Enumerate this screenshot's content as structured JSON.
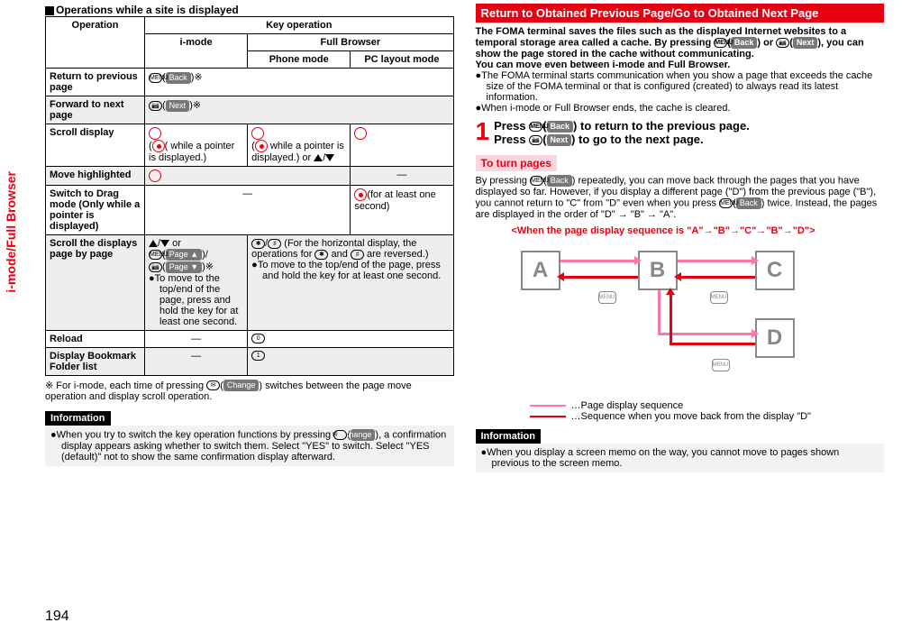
{
  "side_tab": "i-mode/Full Browser",
  "heading_left": "Operations while a site is displayed",
  "table_headers": {
    "operation": "Operation",
    "key_op": "Key operation",
    "imode": "i-mode",
    "fullbrowser": "Full Browser",
    "phone": "Phone mode",
    "pc": "PC layout mode"
  },
  "rows": {
    "r1_op": "Return to previous page",
    "r1_key_pre": "(",
    "r1_key_btn": "Back",
    "r1_key_post": ")※",
    "r2_op": "Forward to next page",
    "r2_key_btn": "Next",
    "r2_key_post": ")※",
    "r3_op": "Scroll display",
    "r3_cell1": "( while a pointer is displayed.)",
    "r3_cell2a": "(",
    "r3_cell2b": " while a pointer is displayed.) or ",
    "r4_op": "Move highlighted",
    "r4_dash": "—",
    "r5_op": "Switch to Drag mode (Only while a pointer is displayed)",
    "r5_dash": "—",
    "r5_pc": "(for at least one second)",
    "r6_op": "Scroll the displays page by page",
    "r6_imode_a": "/",
    "r6_imode_b": " or",
    "r6_btn_page_up": "Page ▲",
    "r6_btn_page_dn": "Page ▼",
    "r6_imode_c": ")※",
    "r6_imode_bullet": "To move to the top/end of the page, press and hold the key for at least one second.",
    "r6_full_a": "/",
    "r6_full_b": " (For the horizontal display, the operations for ",
    "r6_full_c": " and ",
    "r6_full_d": " are reversed.)",
    "r6_full_bullet": "To move to the top/end of the page, press and hold the key for at least one second.",
    "r7_op": "Reload",
    "r7_dash": "—",
    "r8_op": "Display Bookmark Folder list",
    "r8_dash": "—"
  },
  "footnote": "※ For i-mode, each time of pressing ",
  "footnote_btn": "Change",
  "footnote2": ") switches between the page move operation and display scroll operation.",
  "info_label": "Information",
  "info_left": "When you try to switch the key operation functions by pressing ",
  "info_left_btn": "Change",
  "info_left2": "), a confirmation display appears asking whether to switch them. Select \"YES\" to switch. Select \"YES (default)\" not to show the same confirmation display afterward.",
  "red_heading": "Return to Obtained Previous Page/Go to Obtained Next Page",
  "right_para1a": "The FOMA terminal saves the files such as the displayed Internet websites to a temporal storage area called a cache. By pressing ",
  "right_back": "Back",
  "right_or": ") or ",
  "right_next": "Next",
  "right_para1b": "), you can show the page stored in the cache without communicating.",
  "right_para2": "You can move even between i-mode and Full Browser.",
  "right_b1": "The FOMA terminal starts communication when you show a page that exceeds the cache size of the FOMA terminal or that is configured (created) to always read its latest information.",
  "right_b2": "When i-mode or Full Browser ends, the cache is cleared.",
  "step1a": "Press ",
  "step1b": ") to return to the previous page.",
  "step2a": "Press ",
  "step2b": ") to go to the next page.",
  "pink_heading": "To turn pages",
  "turn_p1a": "By pressing ",
  "turn_p1b": ") repeatedly, you can move back through the pages that you have displayed so far. However, if you display a different page (\"D\") from the previous page (\"B\"), you cannot return to \"C\" from \"D\" even when you press ",
  "turn_p1c": ") twice. Instead, the pages are displayed in the order of \"D\" → \"B\" → \"A\".",
  "diag_title": "<When the page display sequence is \"A\"→\"B\"→\"C\"→\"B\"→\"D\">",
  "boxA": "A",
  "boxB": "B",
  "boxC": "C",
  "boxD": "D",
  "menu_lbl": "MENU",
  "legend1": "…Page display sequence",
  "legend2": "…Sequence when you move back from the display \"D\"",
  "info_right": "When you display a screen memo on the way, you cannot move to pages shown previous to the screen memo.",
  "page_number": "194"
}
